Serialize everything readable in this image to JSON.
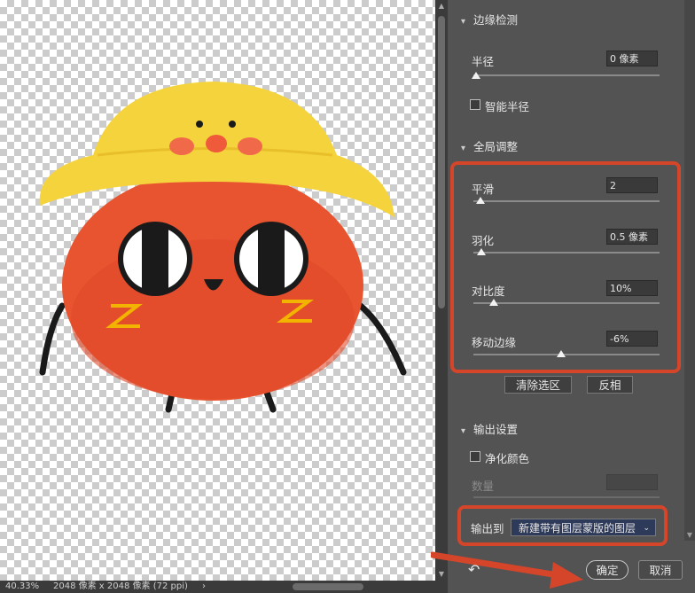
{
  "canvas": {
    "zoom": "40.33%",
    "doc_info": "2048 像素 x 2048 像素 (72 ppi)",
    "nav_arrow": "›"
  },
  "panel": {
    "edge_detection": {
      "title": "边缘检测",
      "radius_label": "半径",
      "radius_value": "0 像素",
      "radius_slider": 0,
      "smart_radius_label": "智能半径",
      "smart_radius_checked": false
    },
    "global_refine": {
      "title": "全局调整",
      "smooth_label": "平滑",
      "smooth_value": "2",
      "smooth_slider": 0.02,
      "feather_label": "羽化",
      "feather_value": "0.5 像素",
      "feather_slider": 0.01,
      "contrast_label": "对比度",
      "contrast_value": "10%",
      "contrast_slider": 0.1,
      "shift_edge_label": "移动边缘",
      "shift_edge_value": "-6%",
      "shift_edge_slider": 0.47,
      "clear_selection_label": "清除选区",
      "invert_label": "反相"
    },
    "output": {
      "title": "输出设置",
      "decontaminate_label": "净化颜色",
      "decontaminate_checked": false,
      "amount_label": "数量",
      "output_to_label": "输出到",
      "output_to_value": "新建带有图层蒙版的图层"
    },
    "ok_label": "确定",
    "cancel_label": "取消"
  },
  "colors": {
    "highlight": "#d4452a",
    "panel_bg": "#535353",
    "select_bg": "#2e3a5a"
  }
}
